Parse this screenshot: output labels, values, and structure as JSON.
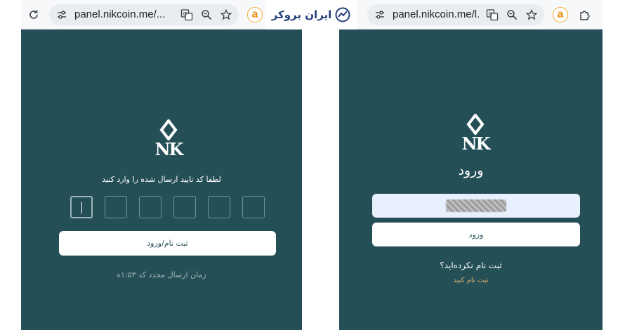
{
  "left_window": {
    "browser": {
      "url": "panel.nikcoin.me/...",
      "extension_letter": "a"
    },
    "logo_text": "NK",
    "prompt": "لطفا کد تایید ارسال شده را وارد کنید",
    "otp": {
      "boxes": 6
    },
    "submit_label": "ثبت نام/ورود",
    "resend_text": "زمان ارسال مجدد کد ۱:۵۳ه"
  },
  "right_window": {
    "browser": {
      "url": "panel.nikcoin.me/l...",
      "extension_letter": "a"
    },
    "logo_text": "NK",
    "title": "ورود",
    "login_button": "ورود",
    "register_question": "ثبت نام نکرده‌اید؟",
    "register_link": "ثبت نام کنید"
  },
  "brand": {
    "name": "ایران بروکر"
  },
  "colors": {
    "panel_bg": "#254f57",
    "browser_bar": "#f7f8fa",
    "link": "#d9b268",
    "autofill_bg": "#e8f0fe",
    "brand": "#23407a"
  }
}
